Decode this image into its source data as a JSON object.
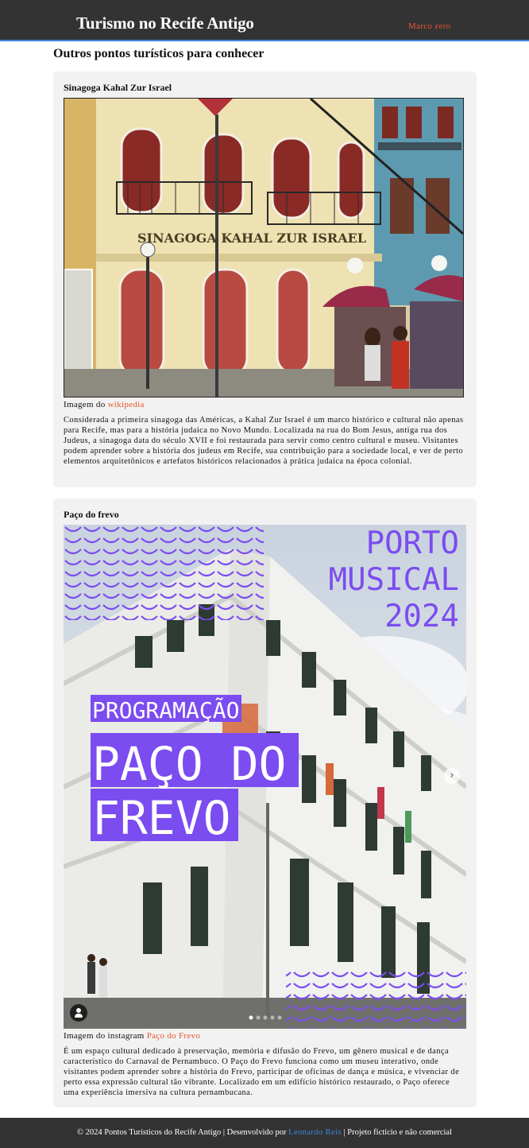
{
  "header": {
    "title": "Turismo no Recife Antigo",
    "nav_link": "Marco zero"
  },
  "section_title": "Outros pontos turísticos para conhecer",
  "cards": [
    {
      "title": "Sinagoga Kahal Zur Israel",
      "photo_sign": "SINAGOGA KAHAL ZUR ISRAEL",
      "caption_prefix": "Imagem do",
      "caption_link": "wikipedia",
      "description": "Considerada a primeira sinagoga das Américas, a Kahal Zur Israel é um marco histórico e cultural não apenas para Recife, mas para a história judaica no Novo Mundo. Localizada na rua do Bom Jesus, antiga rua dos Judeus, a sinagoga data do século XVII e foi restaurada para servir como centro cultural e museu. Visitantes podem aprender sobre a história dos judeus em Recife, sua contribuição para a sociedade local, e ver de perto elementos arquitetônicos e artefatos históricos relacionados à prática judaica na época colonial."
    },
    {
      "title": "Paço do frevo",
      "poster": {
        "line1": "PORTO",
        "line2": "MUSICAL",
        "line3": "2024",
        "programacao": "PROGRAMAÇÃO",
        "paco": "PAÇO DO",
        "frevo": "FREVO"
      },
      "caption_prefix": "Imagem do instagram",
      "caption_link": "Paço do Frevo",
      "description": "É um espaço cultural dedicado à preservação, memória e difusão do Frevo, um gênero musical e de dança característico do Carnaval de Pernambuco. O Paço do Frevo funciona como um museu interativo, onde visitantes podem aprender sobre a história do Frevo, participar de oficinas de dança e música, e vivenciar de perto essa expressão cultural tão vibrante. Localizado em um edifício histórico restaurado, o Paço oferece uma experiência imersiva na cultura pernambucana."
    }
  ],
  "footer": {
    "prefix": "© 2024 Pontos Turísticos do Recife Antigo | Desenvolvido por",
    "author": "Leonardo Reis",
    "suffix": "| Projeto fictício e não comercial"
  },
  "colors": {
    "header_bg": "#333333",
    "accent_link": "#e8562e",
    "footer_link": "#3d85d8",
    "poster_purple": "#7b4cf0"
  }
}
